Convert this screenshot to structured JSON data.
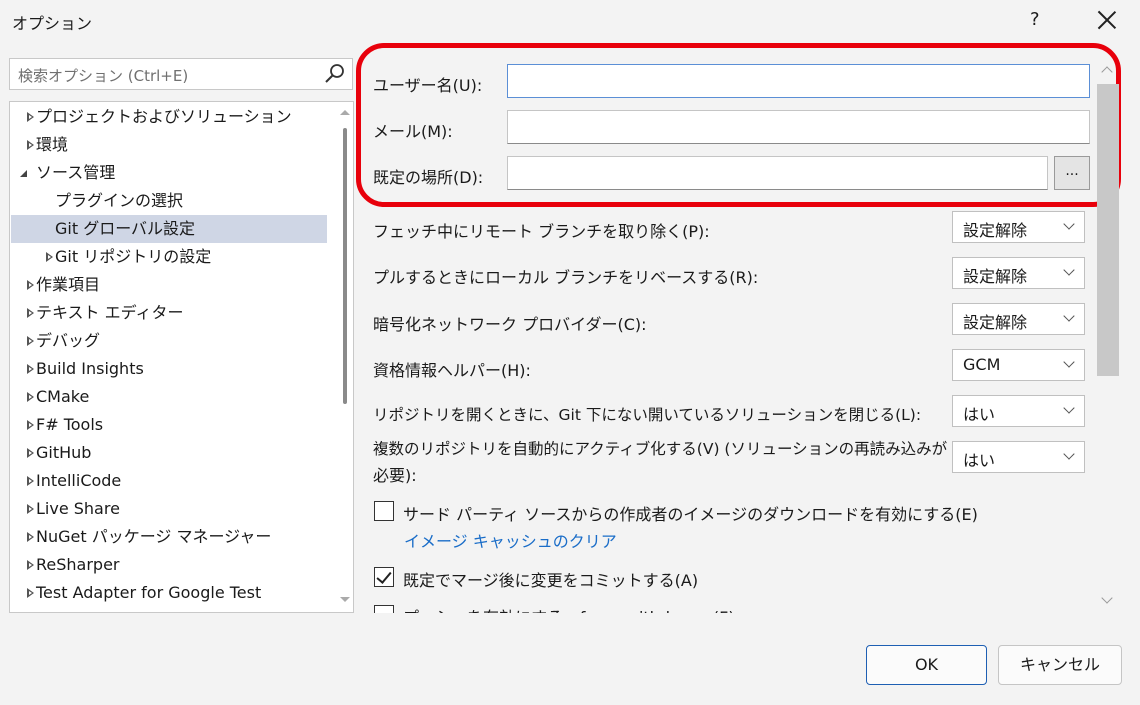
{
  "window": {
    "title": "オプション",
    "help": "?"
  },
  "search": {
    "placeholder": "検索オプション (Ctrl+E)"
  },
  "tree": {
    "items": [
      {
        "label": "プロジェクトおよびソリューション",
        "state": "collapsed",
        "level": 0
      },
      {
        "label": "環境",
        "state": "collapsed",
        "level": 0
      },
      {
        "label": "ソース管理",
        "state": "expanded",
        "level": 0
      },
      {
        "label": "プラグインの選択",
        "state": "none",
        "level": 1
      },
      {
        "label": "Git グローバル設定",
        "state": "none",
        "level": 1,
        "selected": true
      },
      {
        "label": "Git リポジトリの設定",
        "state": "collapsed",
        "level": 1
      },
      {
        "label": "作業項目",
        "state": "collapsed",
        "level": 0
      },
      {
        "label": "テキスト エディター",
        "state": "collapsed",
        "level": 0
      },
      {
        "label": "デバッグ",
        "state": "collapsed",
        "level": 0
      },
      {
        "label": "Build Insights",
        "state": "collapsed",
        "level": 0
      },
      {
        "label": "CMake",
        "state": "collapsed",
        "level": 0
      },
      {
        "label": "F# Tools",
        "state": "collapsed",
        "level": 0
      },
      {
        "label": "GitHub",
        "state": "collapsed",
        "level": 0
      },
      {
        "label": "IntelliCode",
        "state": "collapsed",
        "level": 0
      },
      {
        "label": "Live Share",
        "state": "collapsed",
        "level": 0
      },
      {
        "label": "NuGet パッケージ マネージャー",
        "state": "collapsed",
        "level": 0
      },
      {
        "label": "ReSharper",
        "state": "collapsed",
        "level": 0
      },
      {
        "label": "Test Adapter for Google Test",
        "state": "collapsed",
        "level": 0
      }
    ]
  },
  "fields": {
    "username": {
      "label": "ユーザー名(U):",
      "value": ""
    },
    "email": {
      "label": "メール(M):",
      "value": ""
    },
    "default_location": {
      "label": "既定の場所(D):",
      "value": "",
      "browse": "..."
    }
  },
  "settings": [
    {
      "label": "フェッチ中にリモート ブランチを取り除く(P):",
      "value": "設定解除"
    },
    {
      "label": "プルするときにローカル ブランチをリベースする(R):",
      "value": "設定解除"
    },
    {
      "label": "暗号化ネットワーク プロバイダー(C):",
      "value": "設定解除"
    },
    {
      "label": "資格情報ヘルパー(H):",
      "value": "GCM"
    },
    {
      "label": "リポジトリを開くときに、Git 下にない開いているソリューションを閉じる(L):",
      "value": "はい"
    },
    {
      "label_line1": "複数のリポジトリを自動的にアクティブ化する(V) (ソリューションの再読み込みが",
      "label_line2": "必要):",
      "value": "はい"
    }
  ],
  "checkboxes": [
    {
      "label": "サード パーティ ソースからの作成者のイメージのダウンロードを有効にする(E)",
      "checked": false
    },
    {
      "label": "既定でマージ後に変更をコミットする(A)",
      "checked": true
    },
    {
      "label": "プッシュを有効にする --force-with-lease (F)",
      "checked": false
    }
  ],
  "link": {
    "label": "イメージ キャッシュのクリア"
  },
  "buttons": {
    "ok": "OK",
    "cancel": "キャンセル"
  },
  "colors": {
    "highlight": "#e8000b",
    "selection": "#cfd6e5",
    "link": "#1a6dc8"
  }
}
